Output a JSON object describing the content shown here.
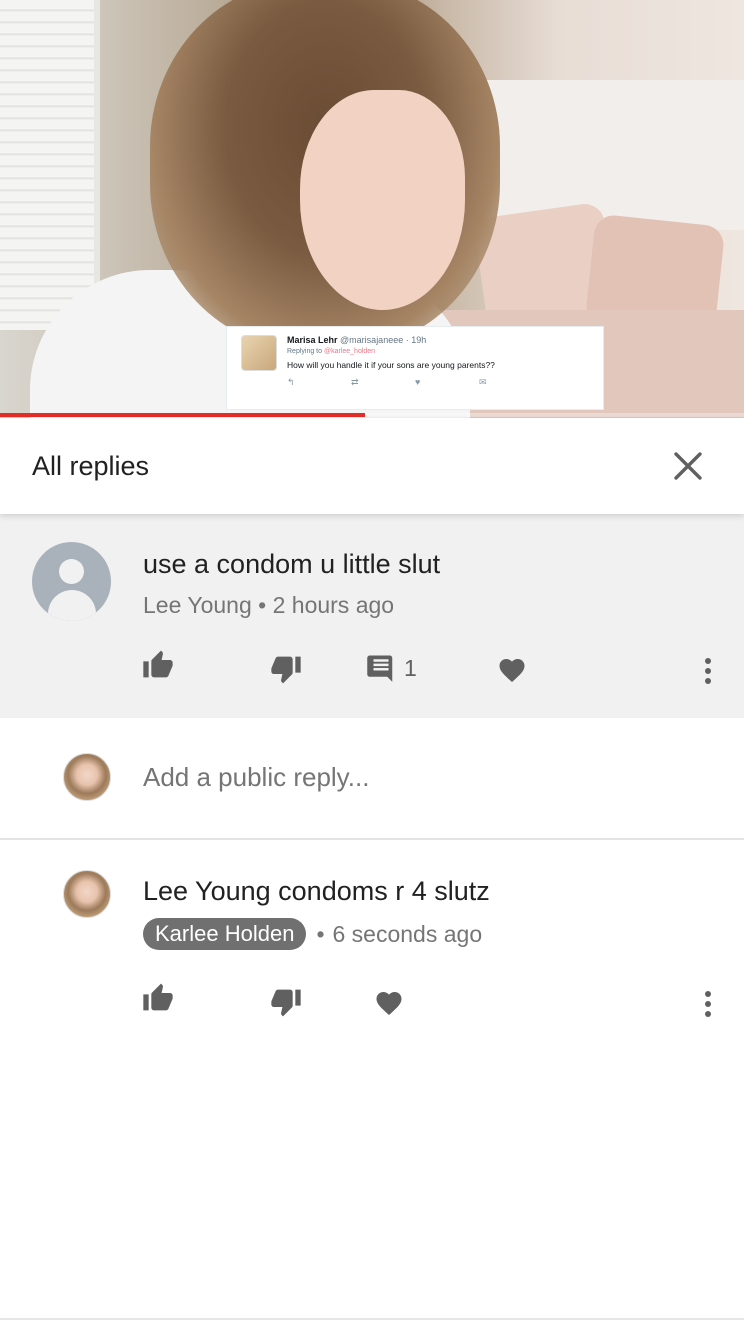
{
  "video": {
    "tweet": {
      "name": "Marisa Lehr",
      "handle": "@marisajaneee",
      "time": "· 19h",
      "replying_prefix": "Replying to",
      "replying_to": "@karlee_holden",
      "text": "How will you handle it if your sons are young parents??"
    },
    "progress_fraction": 0.49,
    "progress_color": "#e52d27"
  },
  "header": {
    "title": "All replies",
    "close_icon": "close-icon"
  },
  "comment": {
    "text": "use a condom u little slut",
    "author": "Lee Young",
    "separator": "•",
    "time": "2 hours ago",
    "reply_count": "1",
    "icons": [
      "thumbs-up-icon",
      "thumbs-down-icon",
      "reply-icon",
      "heart-icon",
      "more-vert-icon"
    ]
  },
  "reply_input": {
    "placeholder": "Add a public reply..."
  },
  "reply": {
    "text": "Lee Young condoms r 4 slutz",
    "author": "Karlee Holden",
    "separator": "•",
    "time": "6 seconds ago",
    "icons": [
      "thumbs-up-icon",
      "thumbs-down-icon",
      "heart-icon",
      "more-vert-icon"
    ]
  }
}
